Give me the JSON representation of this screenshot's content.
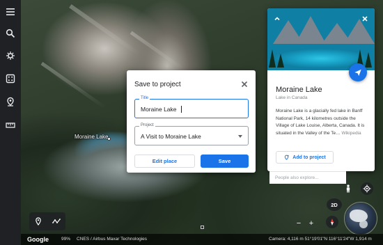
{
  "sidebar": {
    "items": [
      {
        "icon": "menu-icon"
      },
      {
        "icon": "search-icon"
      },
      {
        "icon": "voyager-icon"
      },
      {
        "icon": "random-dice-icon"
      },
      {
        "icon": "projects-icon"
      },
      {
        "icon": "measure-icon"
      }
    ]
  },
  "map": {
    "place_label": "Moraine Lake"
  },
  "dialog": {
    "title": "Save to project",
    "title_field": {
      "label": "Title",
      "value": "Moraine Lake"
    },
    "project_field": {
      "label": "Project",
      "value": "A Visit to Moraine Lake"
    },
    "edit_label": "Edit place",
    "save_label": "Save"
  },
  "card": {
    "name": "Moraine Lake",
    "subtitle": "Lake in Canada",
    "description": "Moraine Lake is a glacially fed lake in Banff National Park, 14 kilometres outside the Village of Lake Louise, Alberta, Canada. It is situated in the Valley of the Te…",
    "source": "Wikipedia",
    "add_label": "Add to project"
  },
  "explore": {
    "placeholder": "People also explore..."
  },
  "controls": {
    "toggle_2d": "2D",
    "zoom_out": "−",
    "zoom_in": "+"
  },
  "status": {
    "logo": "Google",
    "percent": "99%",
    "attribution": "CNES / Airbus   Maxar Technologies",
    "camera": "Camera: 4,116 m   51°19'01\"N 116°11'24\"W   1,914 m"
  },
  "colors": {
    "accent": "#1a73e8",
    "sidebar": "#202124"
  }
}
